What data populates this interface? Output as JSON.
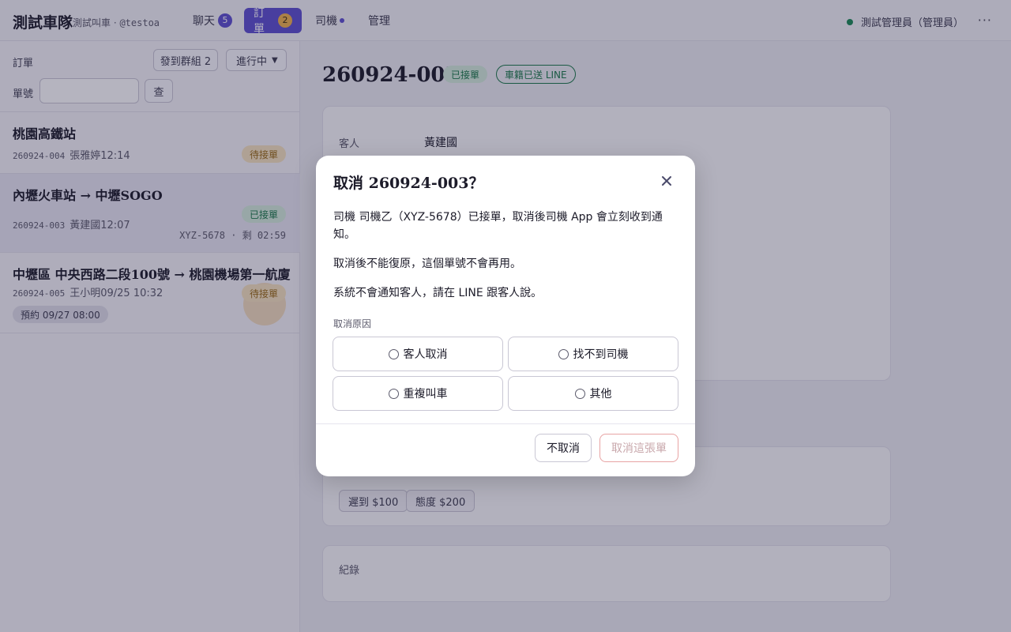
{
  "app": {
    "brand": "測試車隊",
    "subtitle_prefix": "測試叫車 · ",
    "handle": "@testoa"
  },
  "nav": {
    "tabs": [
      {
        "label": "聊天",
        "count": "5"
      },
      {
        "label": "訂單",
        "count": "2"
      },
      {
        "label": "司機"
      },
      {
        "label": "管理"
      }
    ],
    "active": "訂單"
  },
  "user": {
    "label": "測試管理員（管理員）",
    "status_color": "#1a8a55"
  },
  "sidebar": {
    "orders_label": "訂單",
    "send_group_label": "發到群組 2",
    "filter_value": "進行中",
    "number_label": "單號",
    "search_value": "",
    "query_label": "查",
    "items": [
      {
        "title": "桃園高鐵站",
        "id": "260924-004",
        "meta": "張雅婷12:14",
        "status": "待接單"
      },
      {
        "title": "內壢火車站 → 中壢SOGO",
        "id": "260924-003",
        "meta": "黃建國12:07",
        "status": "已接單",
        "sub": "XYZ-5678 · 剩 02:59"
      },
      {
        "title": "中壢區 中央西路二段100號 → 桃園機場第一航廈",
        "id": "260924-005",
        "meta": "王小明09/25 10:32",
        "status": "待接單",
        "pill": "預約 09/27 08:00"
      }
    ]
  },
  "main": {
    "title": "260924-003",
    "status_tag": "已接單",
    "line_tag": "車籍已送 LINE",
    "customer_label": "客人",
    "customer_value": "黃建國",
    "chips": [
      "遲到 $100",
      "態度 $200"
    ],
    "log_label": "紀錄"
  },
  "modal": {
    "title": "取消 260924-003？",
    "p1": "司機 司機乙（XYZ-5678）已接單，取消後司機 App 會立刻收到通知。",
    "p2": "取消後不能復原，這個單號不會再用。",
    "p3": "系統不會通知客人，請在 LINE 跟客人說。",
    "reason_label": "取消原因",
    "reasons": [
      "客人取消",
      "找不到司機",
      "重複叫車",
      "其他"
    ],
    "keep_button": "不取消",
    "confirm_button": "取消這張單"
  },
  "colors": {
    "accent": "#5d4fcf",
    "success": "#1a7a48",
    "warning": "#9a6a14"
  }
}
